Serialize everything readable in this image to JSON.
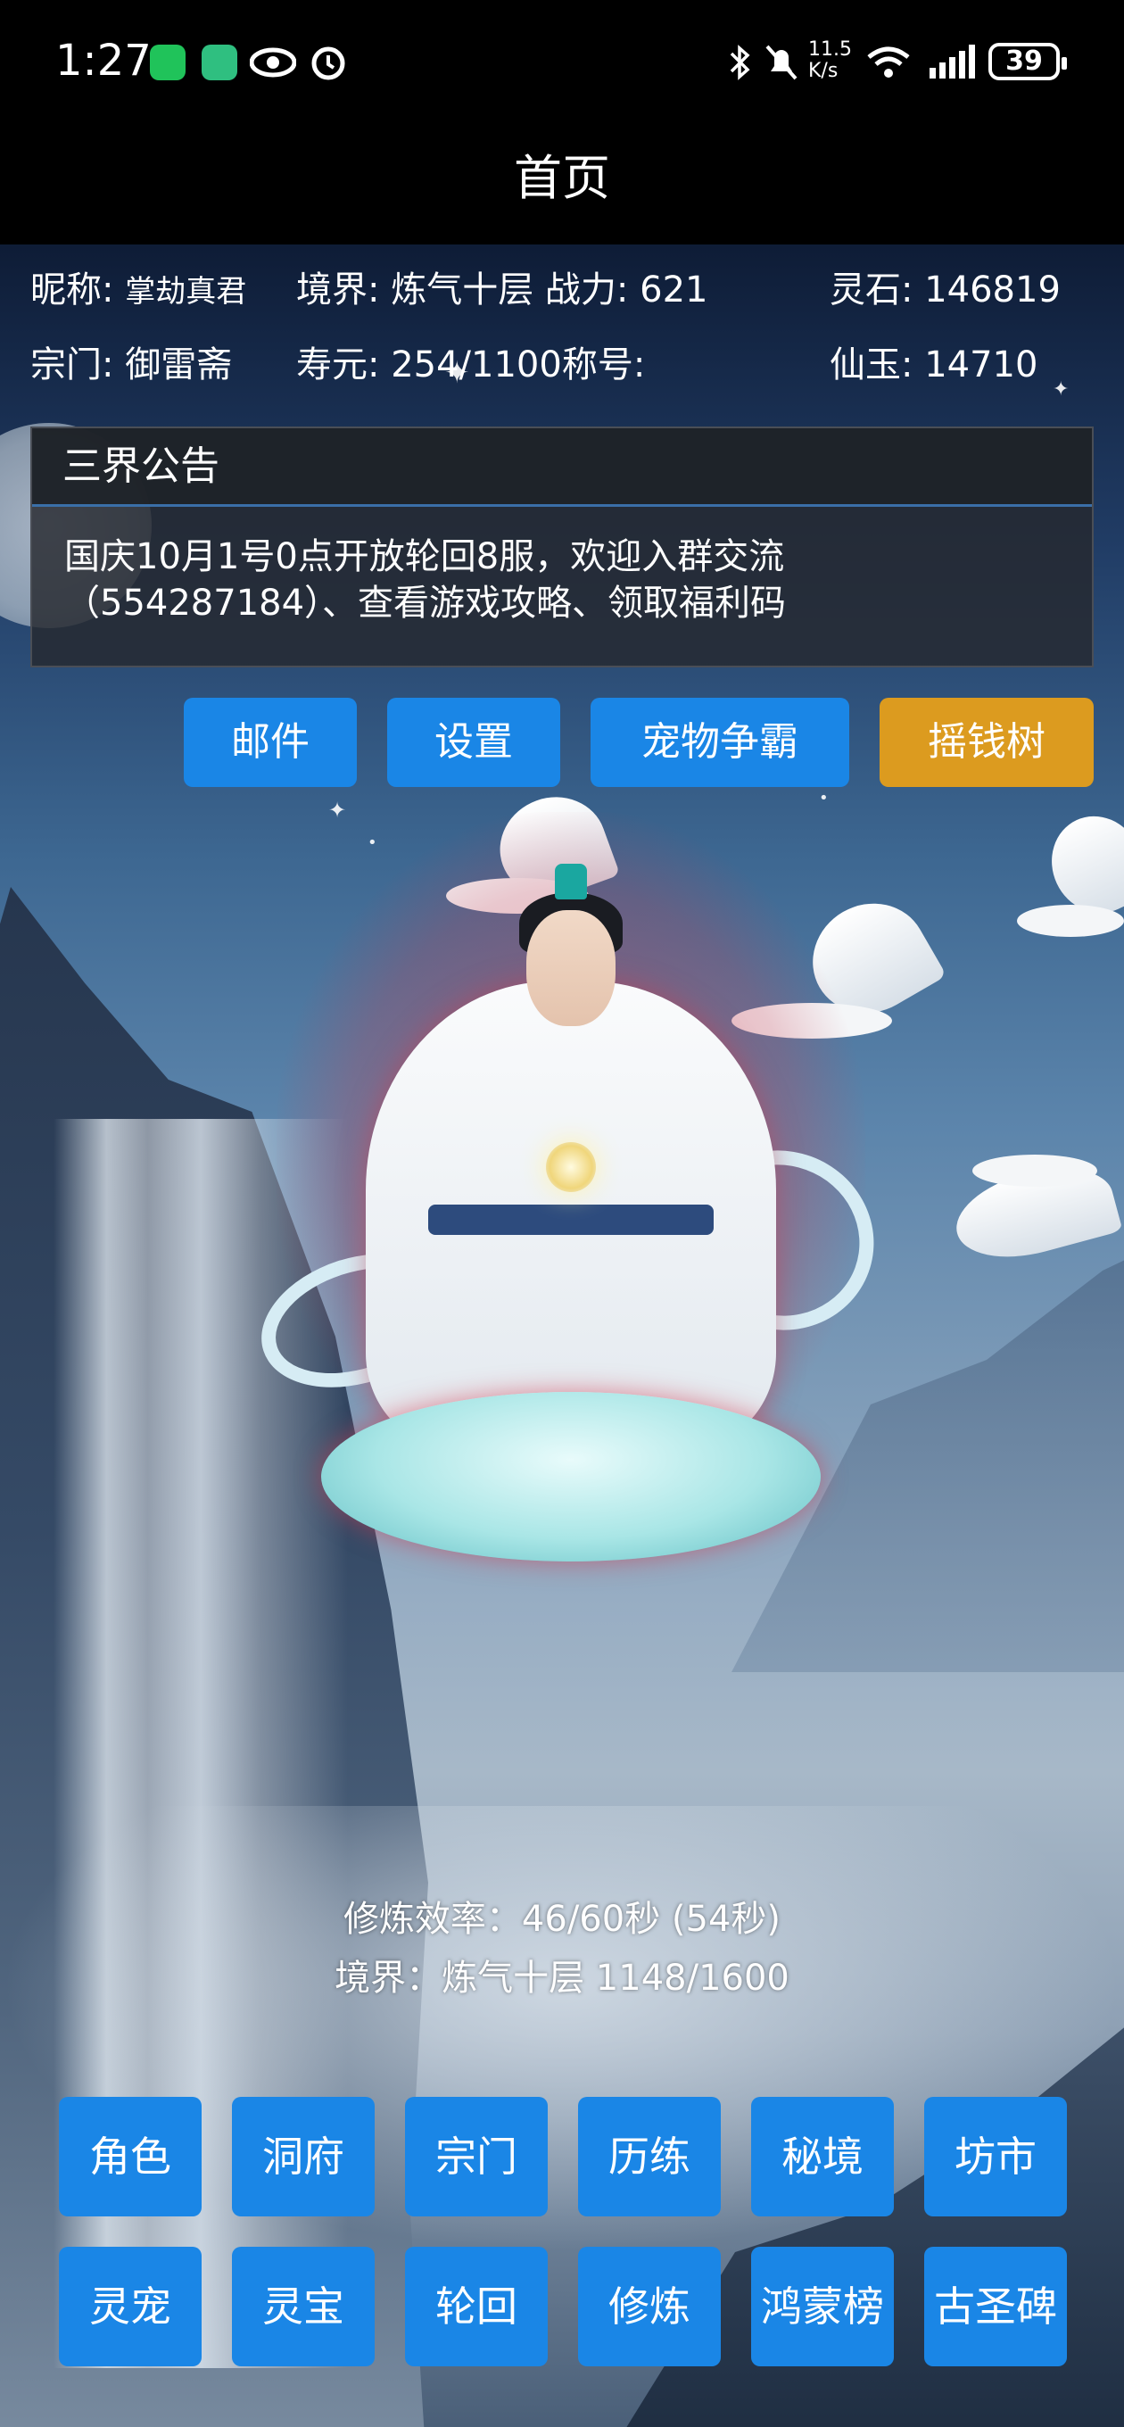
{
  "status_bar": {
    "time": "1:27",
    "net_speed": "11.5 K/s",
    "battery": "39",
    "icons": [
      "wechat-icon",
      "app-icon",
      "eye-icon",
      "alarm-icon",
      "bluetooth-icon",
      "mute-icon",
      "wifi-icon",
      "signal-icon"
    ]
  },
  "header": {
    "title": "首页"
  },
  "player": {
    "nickname_label": "昵称:",
    "nickname": "掌劫真君",
    "realm_label": "境界:",
    "realm": "炼气十层",
    "power_label": "战力:",
    "power": "621",
    "spirit_stone_label": "灵石:",
    "spirit_stone": "146819",
    "sect_label": "宗门:",
    "sect": "御雷斋",
    "lifespan_label": "寿元:",
    "lifespan": "254/1100",
    "title_label": "称号:",
    "title_value": "",
    "jade_label": "仙玉:",
    "jade": "14710"
  },
  "notice": {
    "heading": "三界公告",
    "line1": "国庆10月1号0点开放轮回8服，欢迎入群交流",
    "line2": "（554287184）、查看游戏攻略、领取福利码"
  },
  "actions": {
    "mail": "邮件",
    "settings": "设置",
    "pet_battle": "宠物争霸",
    "money_tree": "摇钱树"
  },
  "cultivation": {
    "efficiency": "修炼效率：46/60秒 (54秒)",
    "realm_progress": "境界：炼气十层 1148/1600"
  },
  "menu": {
    "row1": [
      "角色",
      "洞府",
      "宗门",
      "历练",
      "秘境",
      "坊市"
    ],
    "row2": [
      "灵宠",
      "灵宝",
      "轮回",
      "修炼",
      "鸿蒙榜",
      "古圣碑"
    ]
  },
  "colors": {
    "button_blue": "#1a86e6",
    "button_gold": "#dc9b1f"
  }
}
